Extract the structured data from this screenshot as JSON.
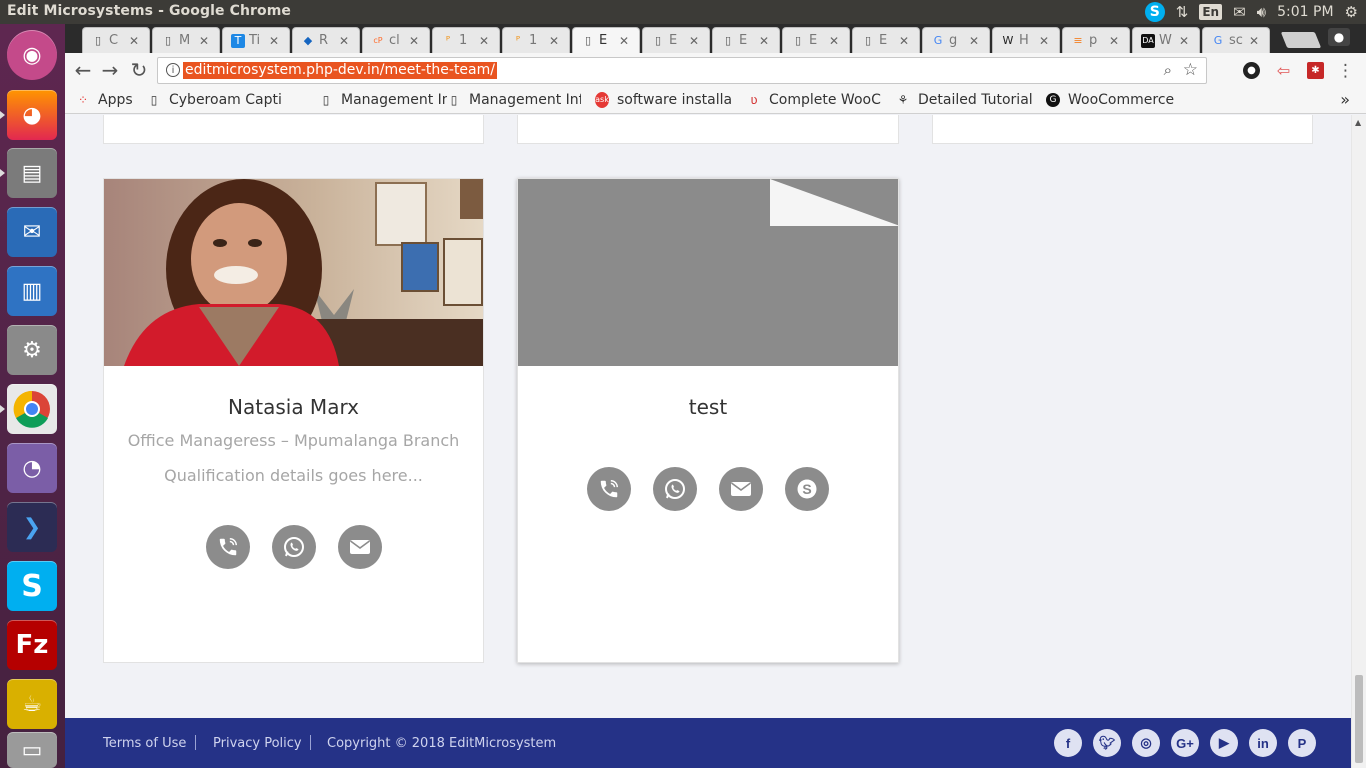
{
  "window": {
    "title": "Edit Microsystems - Google Chrome"
  },
  "tray": {
    "lang": "En",
    "time": "5:01 PM"
  },
  "tabs": [
    {
      "label": "C",
      "favicon": "doc"
    },
    {
      "label": "M",
      "favicon": "doc"
    },
    {
      "label": "Ti",
      "favicon": "T"
    },
    {
      "label": "R",
      "favicon": "globe"
    },
    {
      "label": "cl",
      "favicon": "cp"
    },
    {
      "label": "1",
      "favicon": "pma"
    },
    {
      "label": "1",
      "favicon": "pma"
    },
    {
      "label": "E",
      "favicon": "doc",
      "active": true
    },
    {
      "label": "E",
      "favicon": "doc"
    },
    {
      "label": "E",
      "favicon": "doc"
    },
    {
      "label": "E",
      "favicon": "doc"
    },
    {
      "label": "E",
      "favicon": "doc"
    },
    {
      "label": "g",
      "favicon": "G"
    },
    {
      "label": "H",
      "favicon": "W"
    },
    {
      "label": "p",
      "favicon": "so"
    },
    {
      "label": "W",
      "favicon": "DA"
    },
    {
      "label": "sc",
      "favicon": "G"
    }
  ],
  "address_bar": {
    "url": "editmicrosystem.php-dev.in/meet-the-team/"
  },
  "bookmarks": [
    {
      "label": "Apps"
    },
    {
      "label": "Cyberoam Capti"
    },
    {
      "label": "Management Inf"
    },
    {
      "label": "Management Inf"
    },
    {
      "label": "software installa"
    },
    {
      "label": "Complete WooC"
    },
    {
      "label": "Detailed Tutorial"
    },
    {
      "label": "WooCommerce"
    }
  ],
  "team": [
    {
      "name": "Natasia Marx",
      "role": "Office Manageress – Mpumalanga Branch",
      "qualification": "Qualification details goes here...",
      "contacts": [
        "phone-icon",
        "whatsapp-icon",
        "email-icon"
      ]
    },
    {
      "name": "test",
      "role": "",
      "qualification": "",
      "contacts": [
        "phone-icon",
        "whatsapp-icon",
        "email-icon",
        "skype-icon"
      ]
    }
  ],
  "footer": {
    "links": [
      "Terms of Use",
      "Privacy Policy"
    ],
    "copyright": "Copyright © 2018 EditMicrosystem",
    "social": [
      "facebook-icon",
      "twitter-icon",
      "instagram-icon",
      "google-plus-icon",
      "youtube-icon",
      "linkedin-icon",
      "pinterest-icon"
    ]
  },
  "colors": {
    "footer_bg": "#253287",
    "icon_circle": "#8c8c8c",
    "url_highlight": "#e95420"
  }
}
